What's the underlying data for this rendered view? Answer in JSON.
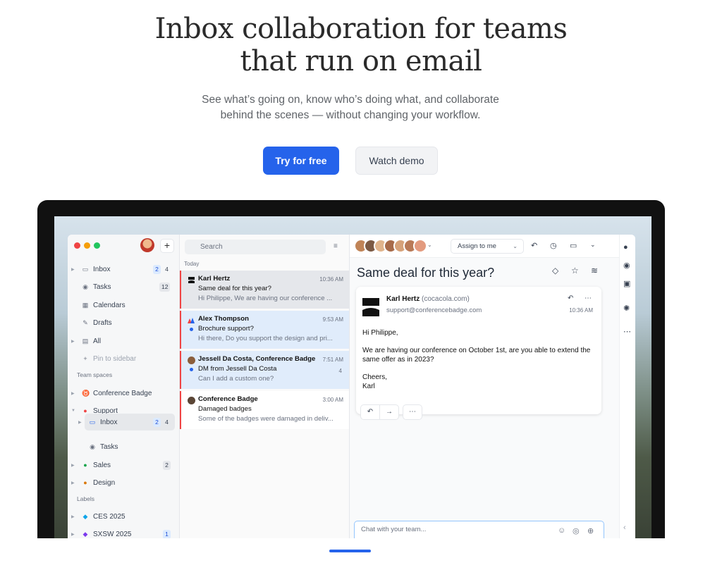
{
  "hero": {
    "title_line1": "Inbox collaboration for teams",
    "title_line2": "that run on email",
    "subtitle_line1": "See what’s going on, know who’s doing what, and collaborate",
    "subtitle_line2": "behind the scenes — without changing your workflow.",
    "primary_cta": "Try for free",
    "secondary_cta": "Watch demo"
  },
  "sidebar": {
    "compose": "+",
    "items": [
      {
        "label": "Inbox",
        "badge1": "2",
        "badge2": "4"
      },
      {
        "label": "Tasks",
        "badge": "12"
      },
      {
        "label": "Calendars"
      },
      {
        "label": "Drafts"
      },
      {
        "label": "All"
      },
      {
        "label": "Pin to sidebar"
      }
    ],
    "team_spaces_label": "Team spaces",
    "teams": [
      {
        "label": "Conference Badge"
      },
      {
        "label": "Support"
      },
      {
        "label": "Inbox",
        "badge1": "2",
        "badge2": "4"
      },
      {
        "label": "Tasks"
      },
      {
        "label": "Sales",
        "badge": "2"
      },
      {
        "label": "Design"
      }
    ],
    "labels_label": "Labels",
    "labels": [
      {
        "label": "CES 2025"
      },
      {
        "label": "SXSW 2025",
        "badge": "1"
      }
    ]
  },
  "list": {
    "search_placeholder": "Search",
    "day": "Today",
    "rows": [
      {
        "who": "Karl Hertz",
        "subject": "Same deal for this year?",
        "preview": "Hi Philippe, We are having our conference ...",
        "time": "10:36 AM"
      },
      {
        "who": "Alex Thompson",
        "subject": "Brochure support?",
        "preview": "Hi there, Do you support the design and pri...",
        "time": "9:53 AM"
      },
      {
        "who": "Jessell Da Costa, Conference Badge",
        "subject": "DM from Jessell Da Costa",
        "preview": "Can I add a custom one?",
        "time": "7:51 AM",
        "count": "4"
      },
      {
        "who": "Conference Badge",
        "subject": "Damaged badges",
        "preview": "Some of the badges were damaged in deliv...",
        "time": "3:00 AM"
      }
    ]
  },
  "reader": {
    "assign_label": "Assign to me",
    "subject": "Same deal for this year?",
    "from_name": "Karl Hertz",
    "from_domain": "(cocacola.com)",
    "from_email": "support@conferencebadge.com",
    "time": "10:36 AM",
    "body": [
      "Hi Philippe,",
      "We are having our conference on October 1st, are you able to extend the same offer as in 2023?",
      "Cheers,",
      "Karl"
    ],
    "chat_placeholder": "Chat with your team..."
  },
  "colors": {
    "accent": "#2563eb",
    "unread_marker": "#ef4444"
  }
}
